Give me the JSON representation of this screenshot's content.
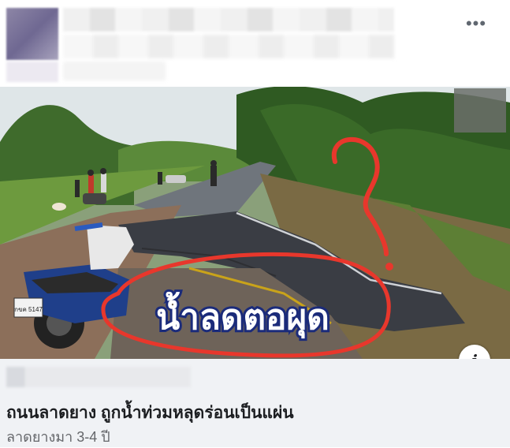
{
  "post": {
    "more_icon": "more-horizontal-icon",
    "more_glyph": "•••"
  },
  "photo": {
    "overlay_text": "น้ำลดตอผุด",
    "plate_text": "กขค 5147",
    "info_glyph": "i",
    "annotation_colors": {
      "circle": "#e8372c",
      "question_mark": "#e8372c"
    }
  },
  "link_preview": {
    "title": "ถนนลาดยาง ถูกน้ำท่วมหลุดร่อนเป็นแผ่น",
    "description": "ลาดยางมา 3-4 ปี"
  }
}
